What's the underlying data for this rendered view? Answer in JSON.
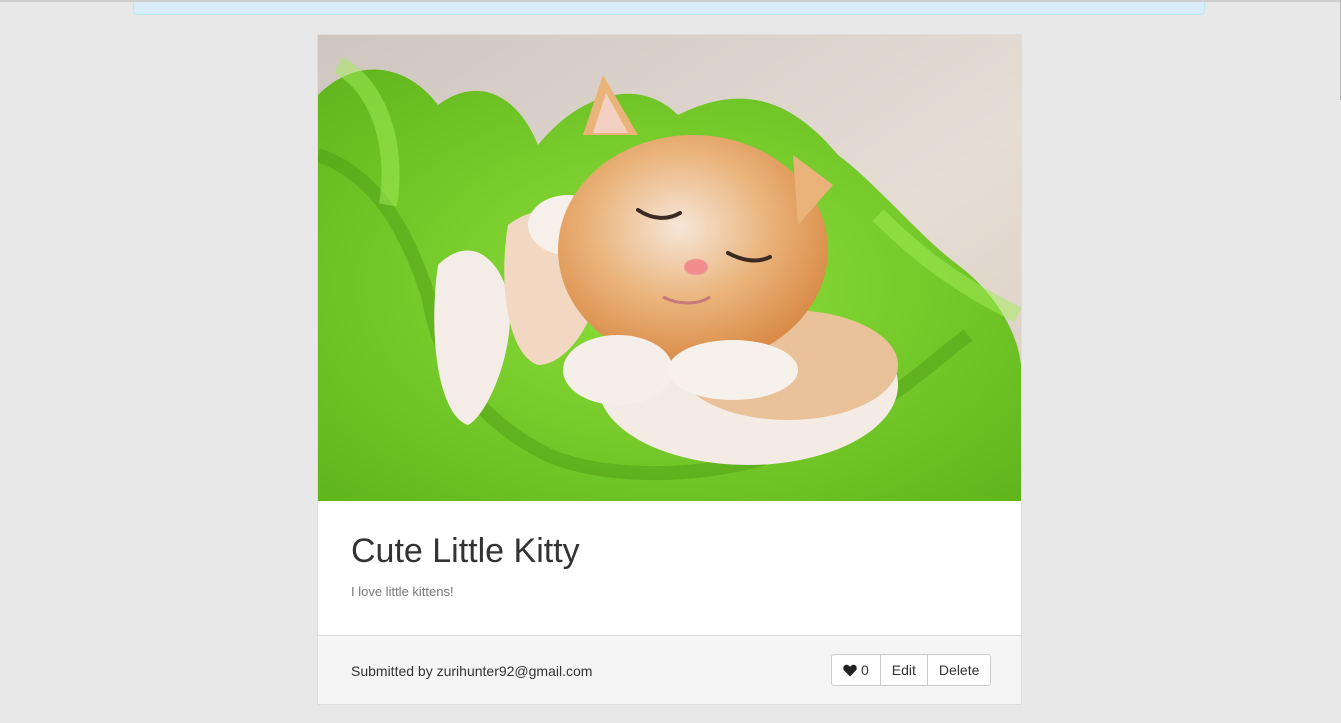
{
  "post": {
    "image_alt": "Sleeping orange kitten wrapped in a green blanket",
    "title": "Cute Little Kitty",
    "description": "I love little kittens!",
    "submitted_by": "Submitted by zurihunter92@gmail.com"
  },
  "actions": {
    "like_icon": "heart-icon",
    "like_count": "0",
    "edit_label": "Edit",
    "delete_label": "Delete"
  },
  "colors": {
    "page_bg": "#e8e8e8",
    "alert_bg": "#d9edf7",
    "blanket_green": "#7fd42a",
    "kitten_orange": "#e8a35f"
  }
}
